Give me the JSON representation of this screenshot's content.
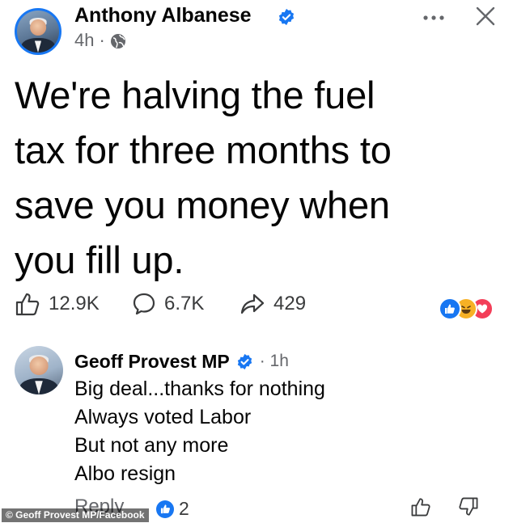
{
  "post": {
    "author": "Anthony Albanese",
    "time": "4h",
    "separator": "·",
    "text_lines": [
      "We're halving the fuel",
      "tax for three months to",
      "save you money when",
      "you fill up."
    ],
    "likes": "12.9K",
    "comments": "6.7K",
    "shares": "429",
    "icons": [
      "more-options-icon",
      "close-icon",
      "globe-icon",
      "verified-badge-icon",
      "like-icon",
      "comment-icon",
      "share-icon"
    ]
  },
  "comment": {
    "author": "Geoff Provest MP",
    "time": "· 1h",
    "lines": [
      "Big deal...thanks for nothing",
      "Always voted Labor",
      "But not any more",
      "Albo resign"
    ],
    "reply_label": "Reply",
    "like_count": "2"
  },
  "watermark": "© Geoff Provest MP/Facebook",
  "colors": {
    "facebook_blue": "#1877f2",
    "text": "#050505",
    "muted": "#65676b",
    "love_red": "#f33e58",
    "haha_yellow": "#f7b125"
  }
}
